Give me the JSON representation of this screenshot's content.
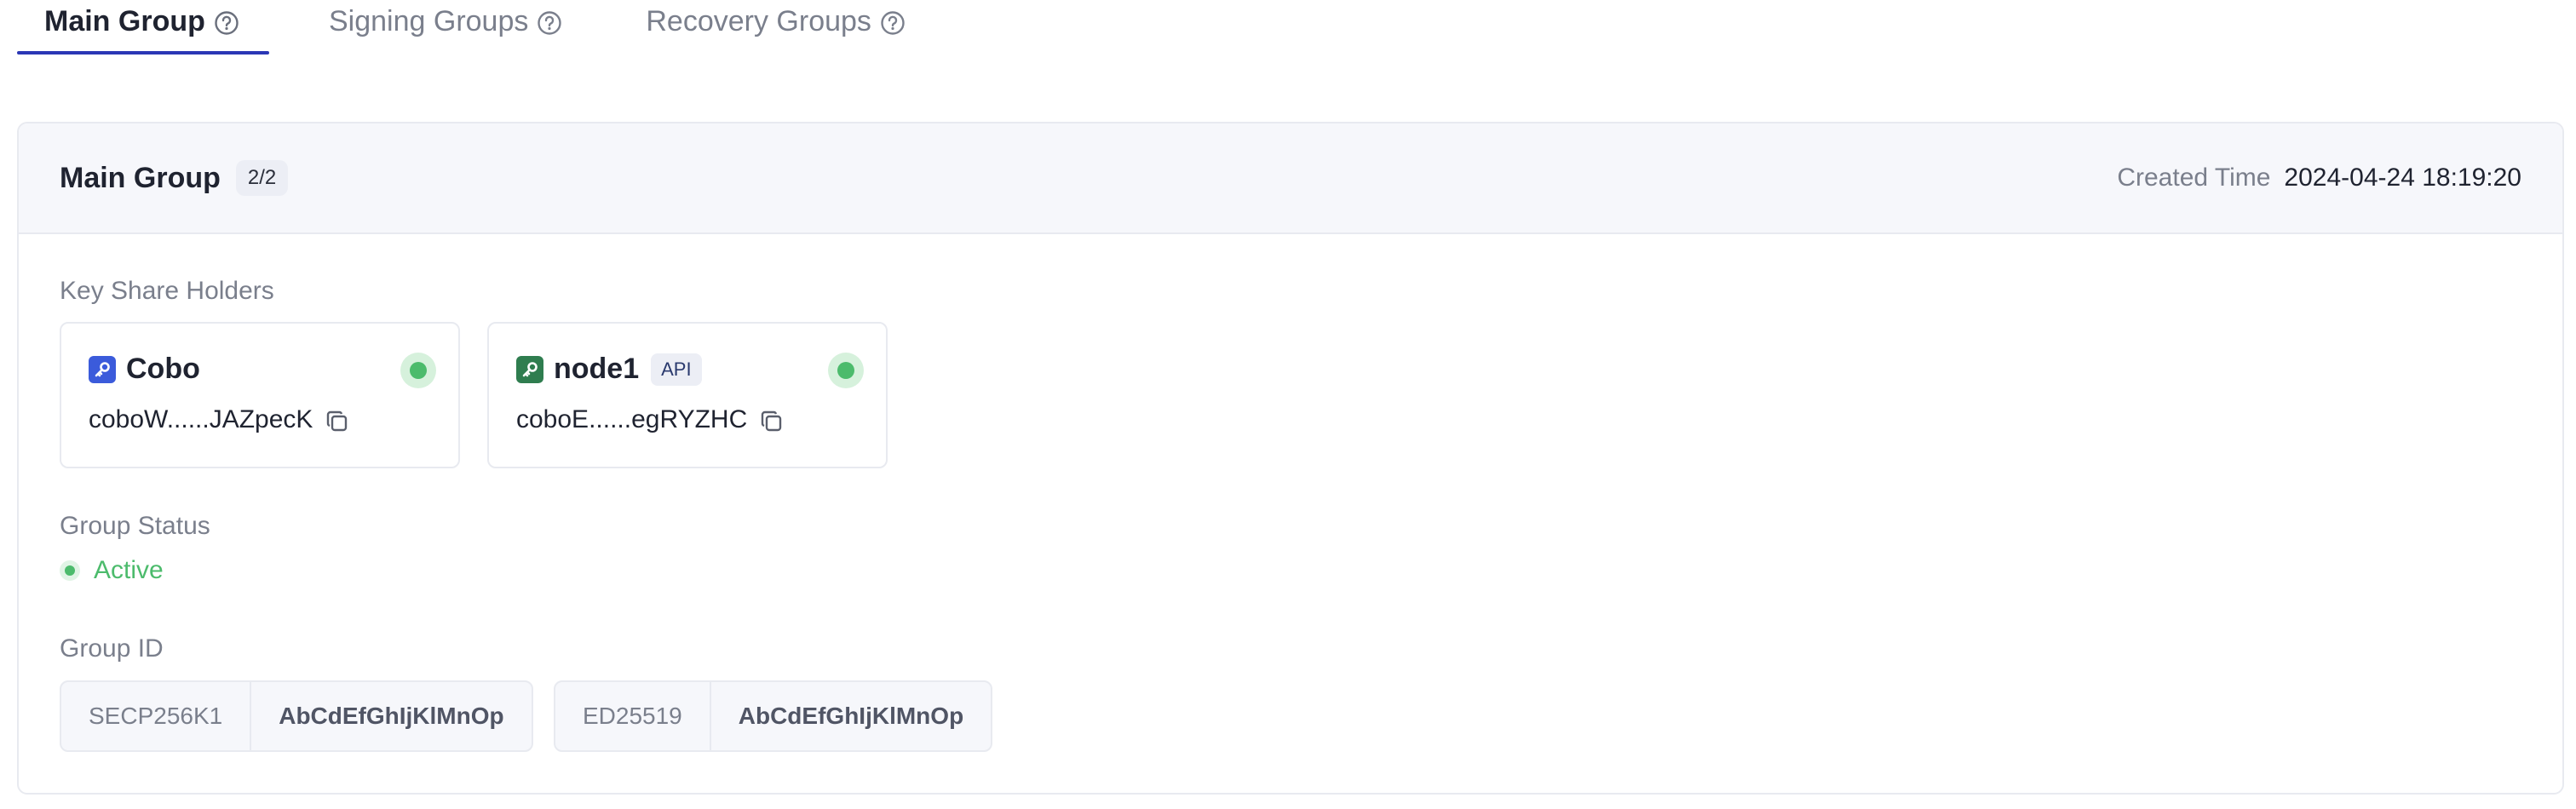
{
  "tabs": [
    {
      "label": "Main Group",
      "active": true
    },
    {
      "label": "Signing Groups",
      "active": false
    },
    {
      "label": "Recovery Groups",
      "active": false
    }
  ],
  "colors": {
    "accent": "#2b37b5",
    "active_green": "#4cbb6c",
    "cobo_icon": "#3b5bdb",
    "node_icon": "#2f7d4f"
  },
  "group": {
    "title": "Main Group",
    "count": "2/2",
    "created_label": "Created Time",
    "created_value": "2024-04-24 18:19:20"
  },
  "key_share_holders": {
    "label": "Key Share Holders",
    "items": [
      {
        "name": "Cobo",
        "badge": "",
        "address": "coboW......JAZpecK",
        "icon": "key-icon",
        "online": true
      },
      {
        "name": "node1",
        "badge": "API",
        "address": "coboE......egRYZHC",
        "icon": "key-icon",
        "online": true
      }
    ]
  },
  "status": {
    "label": "Group Status",
    "value": "Active"
  },
  "group_id": {
    "label": "Group ID",
    "items": [
      {
        "type": "SECP256K1",
        "value": "AbCdEfGhIjKlMnOp"
      },
      {
        "type": "ED25519",
        "value": "AbCdEfGhIjKlMnOp"
      }
    ]
  }
}
